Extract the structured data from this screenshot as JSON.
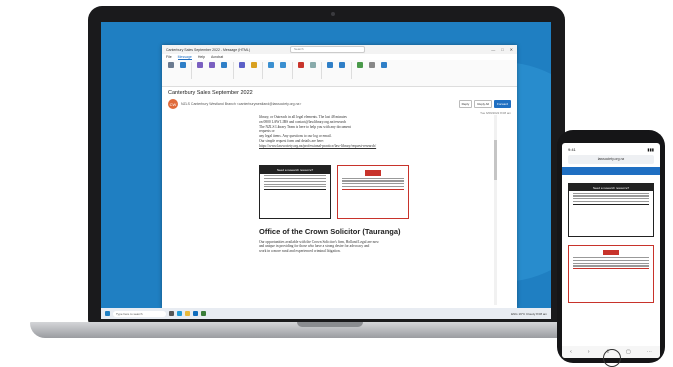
{
  "laptop": {
    "window": {
      "title": "Canterbury Sales September 2022 - Message (HTML)",
      "search_placeholder": "Search",
      "controls": [
        "—",
        "□",
        "✕"
      ],
      "menu": [
        "File",
        "Message",
        "Help",
        "Acrobat"
      ],
      "active_menu": "Message"
    },
    "message": {
      "subject": "Canterbury Sales September 2022",
      "sender": "NZLS Canterbury Westland Branch <canterburywestland@lawsociety.org.nz>",
      "avatar_initials": "CW",
      "actions": [
        "Reply",
        "Reply All",
        "Forward"
      ],
      "date": "Tue 6/09/2022 8:08 am",
      "body_lines": [
        "library, or Outreach in all legal elements. The last 48 minutes",
        "on 0800 LAW LIBS and contact@lawlibrary.org.nz/research",
        "The NZLS Library Team is here to help you with any document",
        "requests or",
        "any legal items. Any questions to our log or email.",
        "Our simple request form and details are here:",
        "https://www.lawsociety.org.nz/professional-practice/law-library/request-research/"
      ],
      "flyer_dark_title": "Need a research resource?",
      "heading": "Office of the Crown Solicitor (Tauranga)",
      "para": [
        "Our opportunities available with the Crown Solicitor's firm, Holland Legal are now",
        "and unique in providing for those who have a strong desire for advocacy and",
        "work in a more rural and experienced criminal litigation."
      ]
    },
    "taskbar": {
      "search": "Type here to search",
      "tray": "ENG 19°C Cloudy 8:08 am"
    }
  },
  "phone": {
    "time": "9:41",
    "url": "lawsociety.org.nz",
    "nav": [
      "‹",
      "›",
      "⇧",
      "▢",
      "⋯"
    ]
  }
}
